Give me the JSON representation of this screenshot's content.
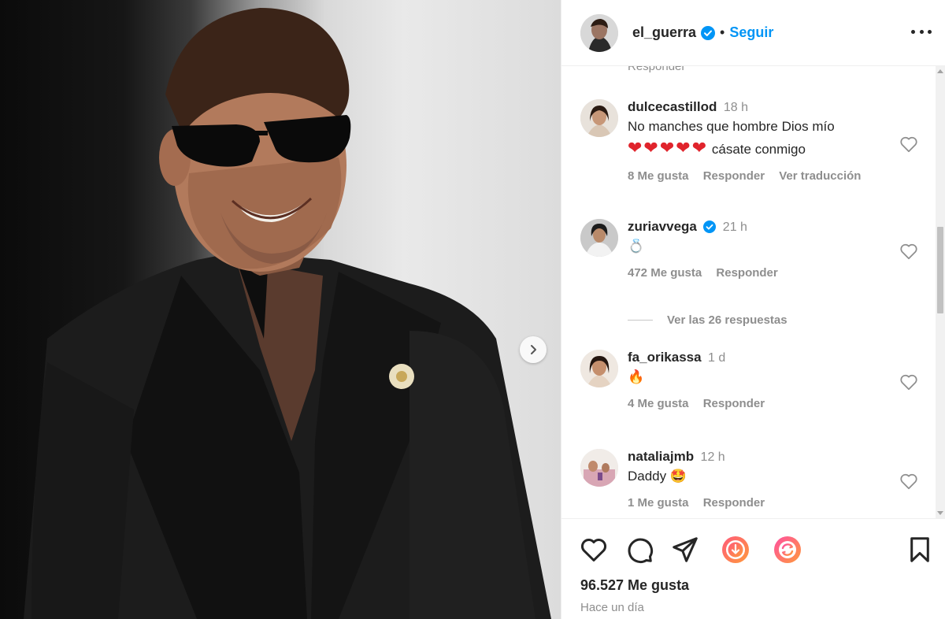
{
  "header": {
    "username": "el_guerra",
    "separator": "•",
    "follow_label": "Seguir"
  },
  "comments_partial_reply": "Responder",
  "comments": [
    {
      "username": "dulcecastillod",
      "time": "18 h",
      "text_line1": "No manches que hombre Dios mío",
      "hearts": "❤❤❤❤❤",
      "text_line2": " cásate conmigo",
      "likes_label": "8 Me gusta",
      "reply_label": "Responder",
      "translate_label": "Ver traducción"
    },
    {
      "username": "zuriavvega",
      "verified": true,
      "time": "21 h",
      "text": "💍",
      "likes_label": "472 Me gusta",
      "reply_label": "Responder"
    },
    {
      "username": "fa_orikassa",
      "time": "1 d",
      "text": "🔥",
      "likes_label": "4 Me gusta",
      "reply_label": "Responder"
    },
    {
      "username": "nataliajmb",
      "time": "12 h",
      "text": "Daddy 🤩",
      "likes_label": "1 Me gusta",
      "reply_label": "Responder"
    }
  ],
  "view_replies_label": "Ver las 26 respuestas",
  "footer": {
    "likes": "96.527 Me gusta",
    "posted": "Hace un día"
  },
  "colors": {
    "accent": "#0095f6",
    "text": "#262626",
    "muted": "#8e8e8e",
    "heart": "#e0242c"
  },
  "icons": [
    "chevron-right-icon",
    "verified-badge-icon",
    "more-options-icon",
    "heart-outline-icon",
    "comment-icon",
    "share-icon",
    "download-icon",
    "repost-icon",
    "bookmark-icon"
  ]
}
